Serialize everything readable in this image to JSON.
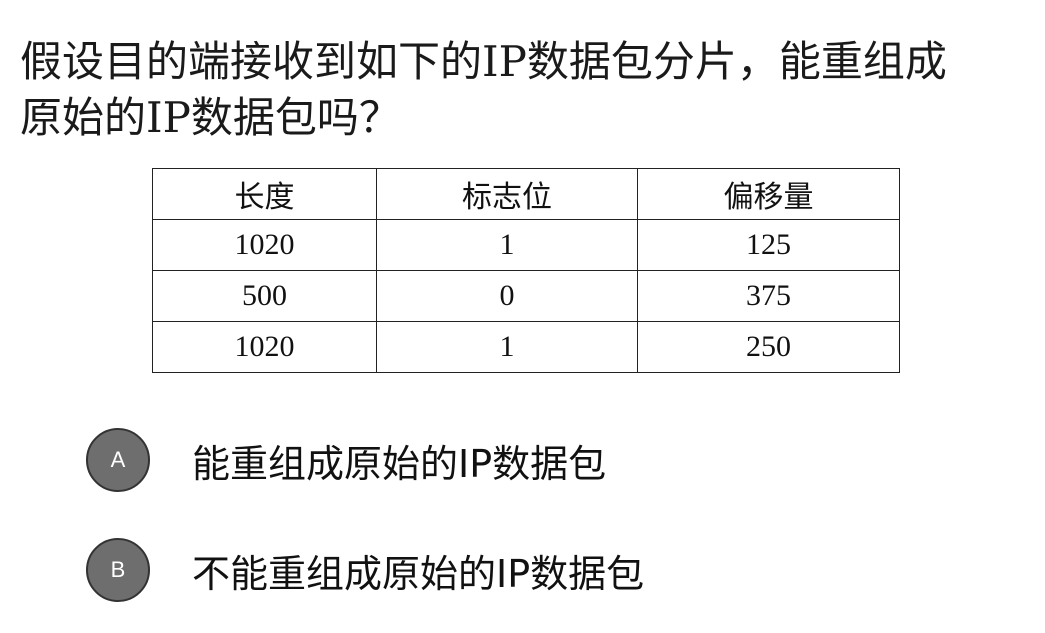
{
  "question": {
    "line1": "假设目的端接收到如下的IP数据包分片，能重组成",
    "line2": "原始的IP数据包吗？"
  },
  "table": {
    "headers": [
      "长度",
      "标志位",
      "偏移量"
    ],
    "rows": [
      [
        "1020",
        "1",
        "125"
      ],
      [
        "500",
        "0",
        "375"
      ],
      [
        "1020",
        "1",
        "250"
      ]
    ]
  },
  "options": [
    {
      "letter": "A",
      "text": "能重组成原始的IP数据包"
    },
    {
      "letter": "B",
      "text": "不能重组成原始的IP数据包"
    }
  ],
  "colors": {
    "badge_fill": "#6e6e6e",
    "badge_border": "#333333"
  }
}
